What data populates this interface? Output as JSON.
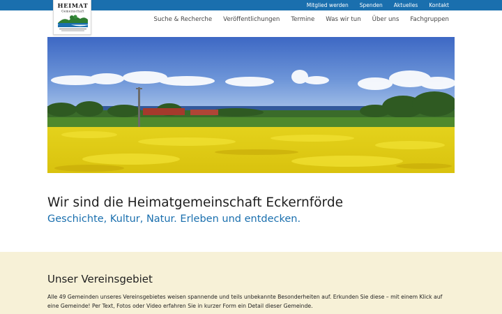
{
  "topnav": {
    "items": [
      "Mitglied werden",
      "Spenden",
      "Aktuelles",
      "Kontakt"
    ]
  },
  "logo": {
    "title": "HEIMAT",
    "subtitle": "Gemeinschaft"
  },
  "mainnav": {
    "items": [
      "Suche & Recherche",
      "Veröffentlichungen",
      "Termine",
      "Was wir tun",
      "Über uns",
      "Fachgruppen"
    ]
  },
  "hero": {
    "icon": "rapeseed-field-landscape-photo"
  },
  "intro": {
    "headline": "Wir sind die Heimatgemeinschaft Eckernförde",
    "tagline": "Geschichte, Kultur, Natur. Erleben und entdecken."
  },
  "region": {
    "title": "Unser Vereinsgebiet",
    "text": "Alle 49 Gemeinden unseres Vereinsgebietes weisen spannende und teils unbekannte Besonderheiten auf. Erkunden Sie diese – mit einem Klick auf eine Gemeinde! Per Text, Fotos oder Video erfahren Sie in kurzer Form ein Detail dieser Gemeinde."
  },
  "colors": {
    "brand_blue": "#1a6fae",
    "section_bg": "#f7f1d7"
  }
}
